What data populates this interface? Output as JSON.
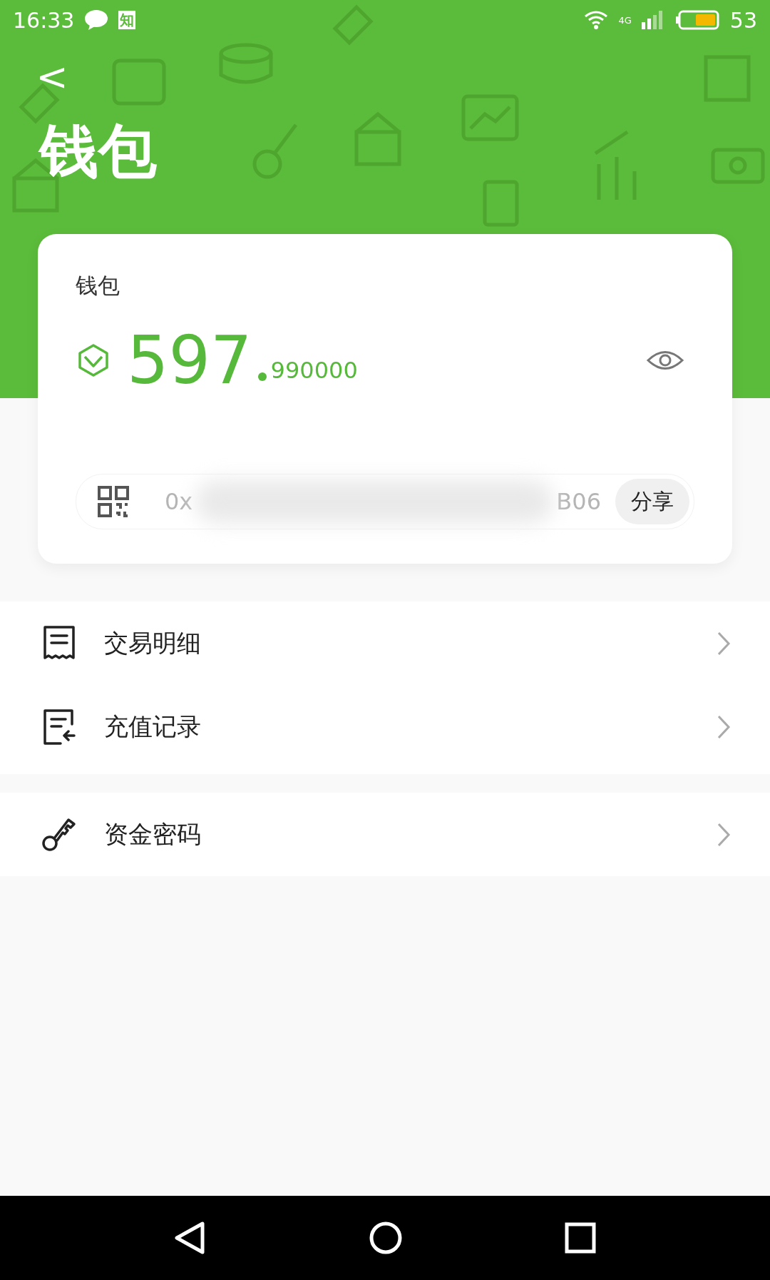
{
  "status_bar": {
    "time": "16:33",
    "app_badge": "知",
    "network": "4G",
    "battery": "53"
  },
  "header": {
    "back": "<",
    "title": "钱包"
  },
  "wallet_card": {
    "label": "钱包",
    "amount_integer": "597",
    "amount_decimal": "990000",
    "address_start": "0x",
    "address_end": "B06",
    "share_button": "分享"
  },
  "menu_groups": [
    [
      {
        "kind": "receipt",
        "label": "交易明细"
      },
      {
        "kind": "recharge",
        "label": "充值记录"
      }
    ],
    [
      {
        "kind": "key",
        "label": "资金密码"
      }
    ]
  ]
}
